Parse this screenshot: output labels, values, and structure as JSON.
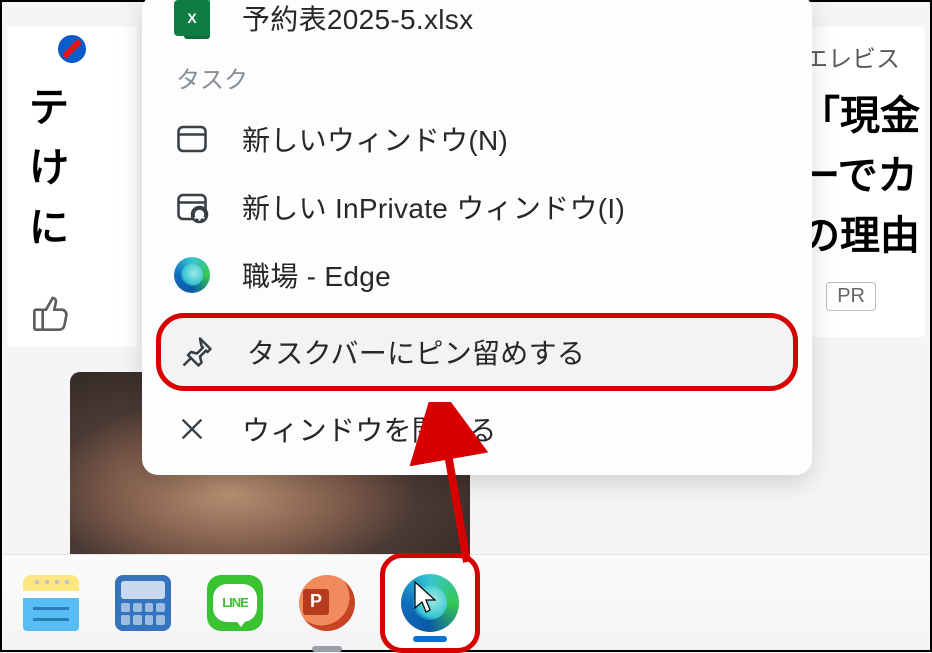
{
  "bg_left": {
    "text": "テ\nけ\nに"
  },
  "bg_right": {
    "sub": "エレビス",
    "text": "「現金\nーでカ\nの理由",
    "pr": "PR"
  },
  "menu": {
    "file_name": "予約表2025-5.xlsx",
    "section_label": "タスク",
    "new_window": "新しいウィンドウ(N)",
    "inprivate": "新しい InPrivate ウィンドウ(I)",
    "profile": "職場 - Edge",
    "pin": "タスクバーにピン留めする",
    "close": "ウィンドウを閉じる"
  },
  "taskbar": {
    "line_label": "LINE"
  }
}
